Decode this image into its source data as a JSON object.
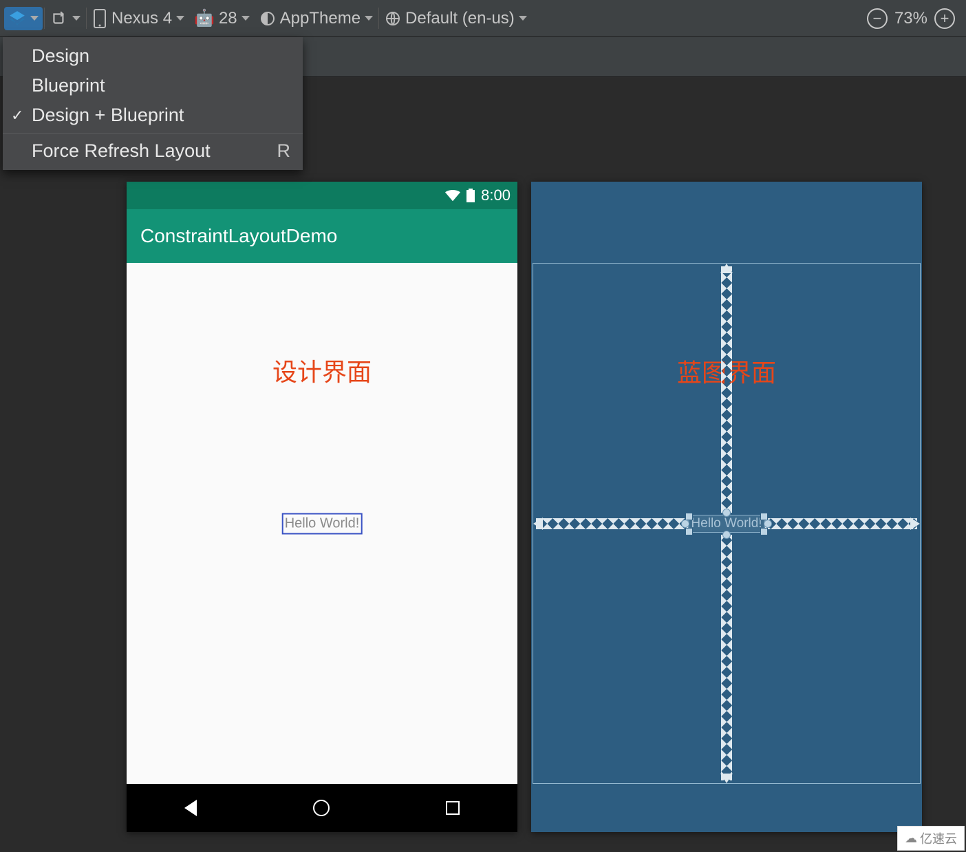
{
  "toolbar": {
    "device_label": "Nexus 4",
    "api_level": "28",
    "theme_label": "AppTheme",
    "locale_label": "Default (en-us)",
    "zoom_level": "73%"
  },
  "dropdown": {
    "items": [
      {
        "label": "Design",
        "checked": false
      },
      {
        "label": "Blueprint",
        "checked": false
      },
      {
        "label": "Design + Blueprint",
        "checked": true
      }
    ],
    "extra": {
      "label": "Force Refresh Layout",
      "shortcut": "R"
    }
  },
  "device": {
    "status_time": "8:00",
    "app_title": "ConstraintLayoutDemo",
    "hello_text": "Hello World!"
  },
  "annotations": {
    "design": "设计界面",
    "blueprint": "蓝图界面"
  },
  "watermark": "亿速云"
}
